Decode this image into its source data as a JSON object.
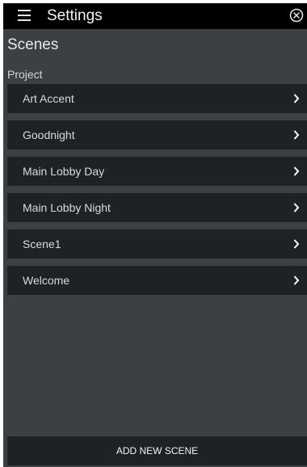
{
  "header": {
    "title": "Settings",
    "menu_icon": "hamburger-menu-icon",
    "close_icon": "close-circle-icon"
  },
  "page": {
    "title": "Scenes",
    "section_label": "Project"
  },
  "scenes": [
    {
      "label": "Art Accent"
    },
    {
      "label": "Goodnight"
    },
    {
      "label": "Main Lobby Day"
    },
    {
      "label": "Main Lobby Night"
    },
    {
      "label": "Scene1"
    },
    {
      "label": "Welcome"
    }
  ],
  "footer": {
    "add_button_label": "ADD NEW SCENE"
  },
  "colors": {
    "header_bg": "#000000",
    "page_bg": "#3c3f44",
    "row_bg": "#1e2227",
    "text": "#d9d9d9"
  }
}
